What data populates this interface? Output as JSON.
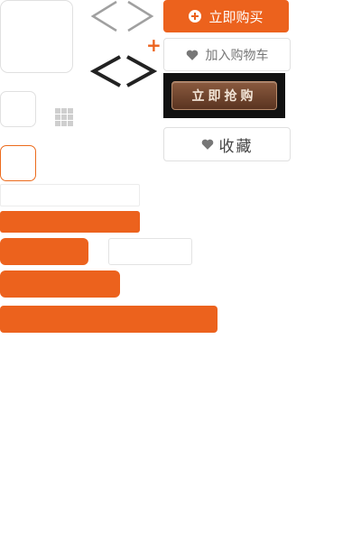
{
  "buttons": {
    "buy_now_label": "立即购买",
    "add_to_cart_label": "加入购物车",
    "rush_buy_label": "立即抢购",
    "favorite_label": "收藏"
  },
  "decor": {
    "plus_sign": "+"
  },
  "colors": {
    "accent": "#ec621d",
    "border": "#e0e0e0",
    "arrow_gray": "#a0a0a0",
    "arrow_dark": "#222222"
  },
  "icons": {
    "prev_arrow": "chevron-left-icon",
    "next_arrow": "chevron-right-icon",
    "heart": "heart-icon",
    "grid": "grid-icon",
    "add": "plus-circle-icon"
  }
}
